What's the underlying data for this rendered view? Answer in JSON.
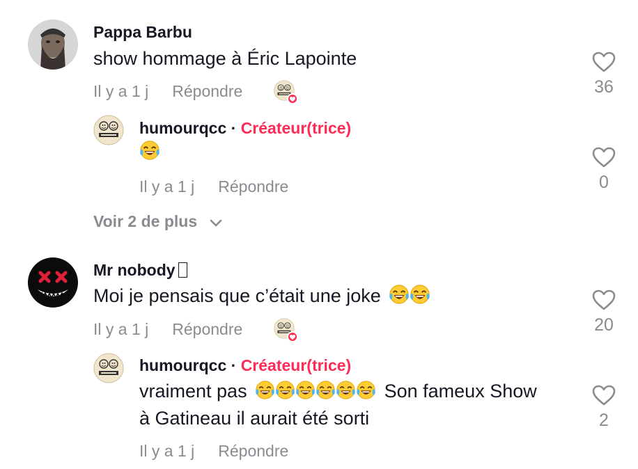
{
  "comments": [
    {
      "username": "Pappa Barbu",
      "text": "show hommage à Éric Lapointe",
      "time": "Il y a 1 j",
      "reply_label": "Répondre",
      "likes": "36",
      "replies": [
        {
          "username": "humourqcc",
          "creator_label": "Créateur(trice)",
          "text": "",
          "time": "Il y a 1 j",
          "reply_label": "Répondre",
          "likes": "0"
        }
      ],
      "more_label": "Voir 2 de plus"
    },
    {
      "username": "Mr nobody",
      "text": "Moi je pensais que c’était une joke",
      "time": "Il y a 1 j",
      "reply_label": "Répondre",
      "likes": "20",
      "replies": [
        {
          "username": "humourqcc",
          "creator_label": "Créateur(trice)",
          "text_line1": "vraiment pas",
          "text_line1_after": "Son fameux Show",
          "text_line2": "à Gatineau il aurait été sorti",
          "time": "Il y a 1 j",
          "reply_label": "Répondre",
          "likes": "2"
        }
      ]
    }
  ],
  "icons": {
    "like": "heart-outline-icon",
    "expand": "chevron-down-icon",
    "emoji": "face-with-tears-of-joy-icon"
  },
  "colors": {
    "creator": "#fe2c55",
    "secondary_text": "#8a8b91",
    "primary_text": "#161823"
  }
}
